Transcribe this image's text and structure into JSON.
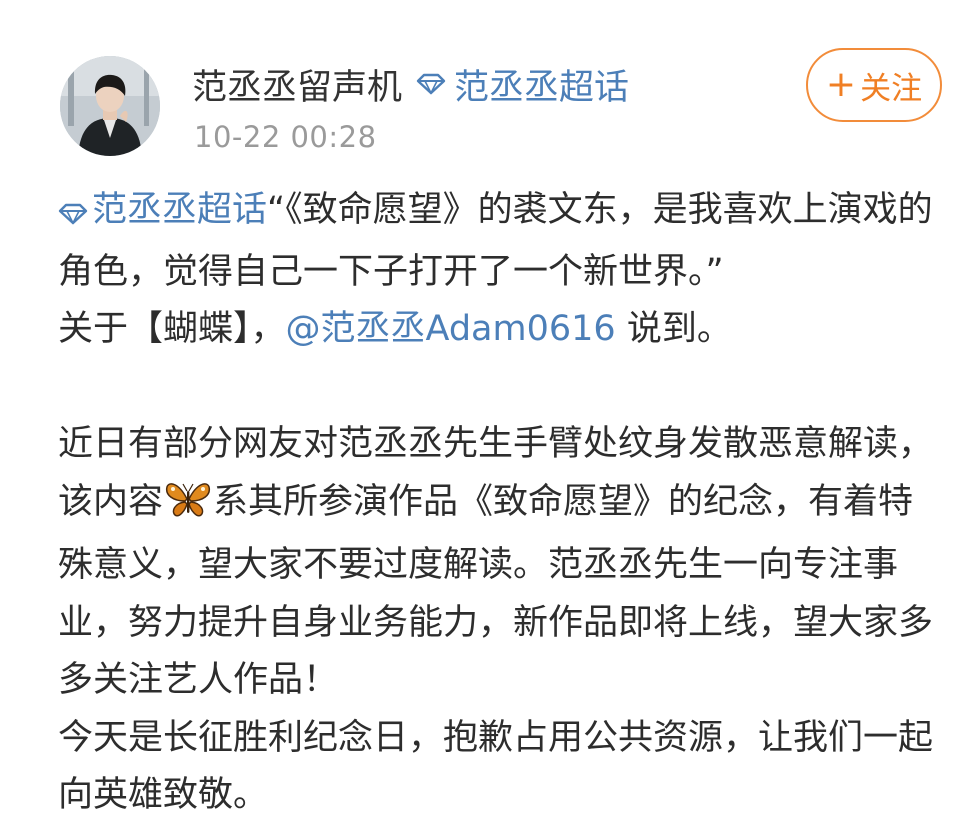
{
  "author": {
    "name": "范丞丞留声机",
    "supertopic_label": "范丞丞超话",
    "timestamp": "10-22 00:28"
  },
  "follow_button": {
    "plus": "+",
    "label": "关注"
  },
  "post": {
    "line1_topic": "范丞丞超话",
    "line1_quote": "“《致命愿望》的裘文东，是我喜欢上演戏的角色，觉得自己一下子打开了一个新世界。”",
    "line2_prefix": "关于【蝴蝶】，",
    "line2_mention": "@范丞丞Adam0616",
    "line2_suffix": " 说到。",
    "para2_before_emoji": "近日有部分网友对范丞丞先生手臂处纹身发散恶意解读，该内容",
    "para2_emoji": "butterfly-emoji",
    "para2_after_emoji": "系其所参演作品《致命愿望》的纪念，有着特殊意义，望大家不要过度解读。范丞丞先生一向专注事业，努力提升自身业务能力，新作品即将上线，望大家多多关注艺人作品！",
    "para3": "今天是长征胜利纪念日，抱歉占用公共资源，让我们一起向英雄致敬。"
  },
  "colors": {
    "link_blue": "#4c7fb8",
    "follow_orange": "#f07f24",
    "timestamp_gray": "#9a9a9a",
    "text": "#2d2d2d"
  },
  "icons": {
    "supertopic": "diamond-icon",
    "avatar": "avatar-photo"
  }
}
